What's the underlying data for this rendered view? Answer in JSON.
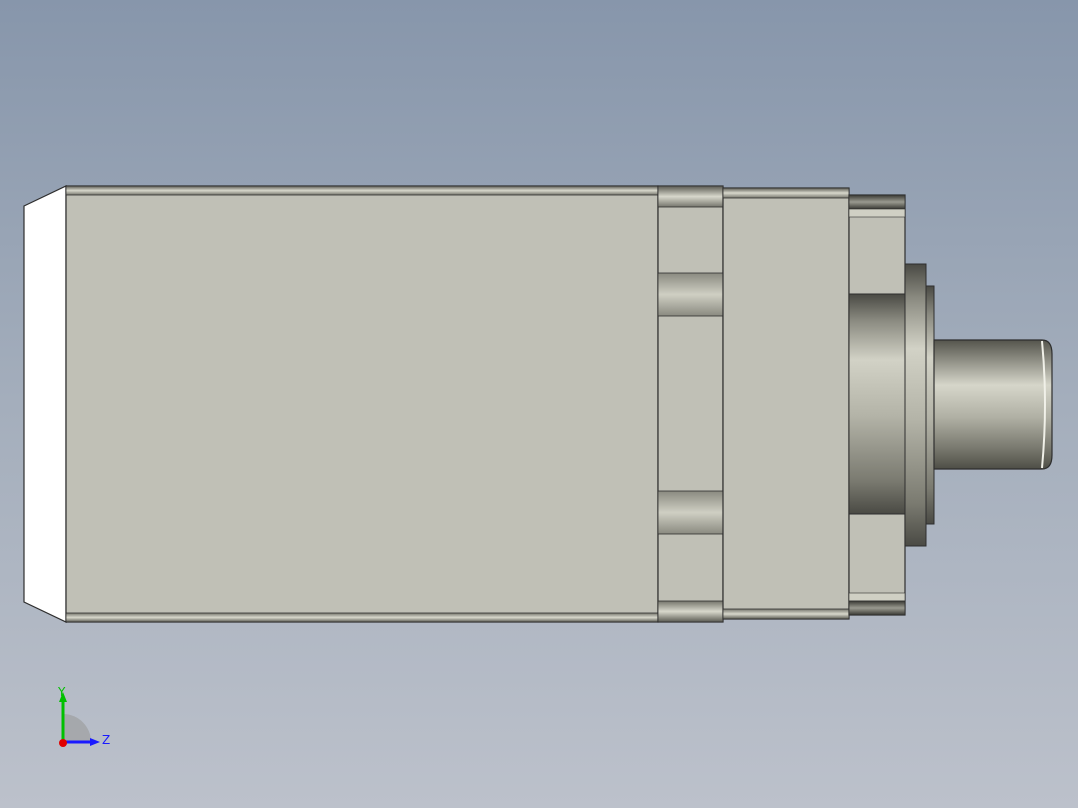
{
  "triad": {
    "y_label": "Y",
    "z_label": "Z",
    "colors": {
      "y_axis": "#00c000",
      "z_axis": "#1a1aff",
      "x_axis": "#e00000"
    }
  },
  "model": {
    "colors": {
      "body": "#c0c0b6",
      "edge": "#2e2e2e",
      "cap": "#ffffff",
      "metal_dark": "#5a5a52",
      "metal_light": "#d8d8cc"
    }
  }
}
